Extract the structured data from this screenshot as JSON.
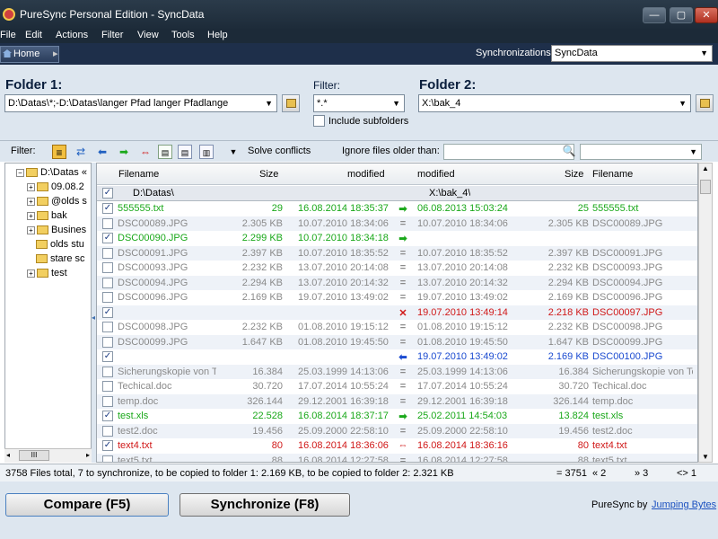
{
  "window": {
    "title": "PureSync Personal Edition  -  SyncData",
    "min": "—",
    "max": "▢",
    "close": "✕"
  },
  "menu": [
    "File",
    "Edit",
    "Actions",
    "Filter",
    "View",
    "Tools",
    "Help"
  ],
  "nav": {
    "home": "Home",
    "sync_label": "Synchronizations:",
    "sync_value": "SyncData"
  },
  "folder1": {
    "label": "Folder 1:",
    "path": "D:\\Datas\\*;-D:\\Datas\\langer Pfad langer Pfadlange"
  },
  "filter": {
    "label": "Filter:",
    "value": "*.*",
    "include_subfolders": "Include subfolders"
  },
  "folder2": {
    "label": "Folder 2:",
    "path": "X:\\bak_4"
  },
  "toolbar": {
    "filter_label": "Filter:",
    "solve_conflicts": "Solve conflicts",
    "ignore_label": "Ignore files older than:"
  },
  "tree": {
    "root": "D:\\Datas «",
    "items": [
      {
        "label": "09.08.2",
        "expand": true
      },
      {
        "label": "@olds s",
        "expand": true
      },
      {
        "label": "bak",
        "expand": true
      },
      {
        "label": "Busines",
        "expand": true
      },
      {
        "label": "olds stu",
        "expand": false
      },
      {
        "label": "stare sc",
        "expand": false
      },
      {
        "label": "test",
        "expand": true
      }
    ],
    "scroll_thumb": "III"
  },
  "columns": {
    "filename1": "Filename",
    "size1": "Size",
    "modified1": "modified",
    "modified2": "modified",
    "size2": "Size",
    "filename2": "Filename"
  },
  "folder_row": {
    "left": "D:\\Datas\\",
    "right": "X:\\bak_4\\"
  },
  "rows": [
    {
      "checked": true,
      "name1": "555555.txt",
      "size1": "29",
      "mod1": "16.08.2014 18:35:37",
      "action": "➡",
      "mod2": "06.08.2013 15:03:24",
      "size2": "25",
      "name2": "555555.txt",
      "color": "#1aa81a"
    },
    {
      "checked": false,
      "name1": "DSC00089.JPG",
      "size1": "2.305 KB",
      "mod1": "10.07.2010 18:34:06",
      "action": "=",
      "mod2": "10.07.2010 18:34:06",
      "size2": "2.305 KB",
      "name2": "DSC00089.JPG",
      "color": "#8a8a8a"
    },
    {
      "checked": true,
      "name1": "DSC00090.JPG",
      "size1": "2.299 KB",
      "mod1": "10.07.2010 18:34:18",
      "action": "➡",
      "mod2": "",
      "size2": "",
      "name2": "",
      "color": "#1aa81a"
    },
    {
      "checked": false,
      "name1": "DSC00091.JPG",
      "size1": "2.397 KB",
      "mod1": "10.07.2010 18:35:52",
      "action": "=",
      "mod2": "10.07.2010 18:35:52",
      "size2": "2.397 KB",
      "name2": "DSC00091.JPG",
      "color": "#8a8a8a"
    },
    {
      "checked": false,
      "name1": "DSC00093.JPG",
      "size1": "2.232 KB",
      "mod1": "13.07.2010 20:14:08",
      "action": "=",
      "mod2": "13.07.2010 20:14:08",
      "size2": "2.232 KB",
      "name2": "DSC00093.JPG",
      "color": "#8a8a8a"
    },
    {
      "checked": false,
      "name1": "DSC00094.JPG",
      "size1": "2.294 KB",
      "mod1": "13.07.2010 20:14:32",
      "action": "=",
      "mod2": "13.07.2010 20:14:32",
      "size2": "2.294 KB",
      "name2": "DSC00094.JPG",
      "color": "#8a8a8a"
    },
    {
      "checked": false,
      "name1": "DSC00096.JPG",
      "size1": "2.169 KB",
      "mod1": "19.07.2010 13:49:02",
      "action": "=",
      "mod2": "19.07.2010 13:49:02",
      "size2": "2.169 KB",
      "name2": "DSC00096.JPG",
      "color": "#8a8a8a"
    },
    {
      "checked": true,
      "name1": "",
      "size1": "",
      "mod1": "",
      "action": "✕",
      "mod2": "19.07.2010 13:49:14",
      "size2": "2.218 KB",
      "name2": "DSC00097.JPG",
      "color": "#d01818"
    },
    {
      "checked": false,
      "name1": "DSC00098.JPG",
      "size1": "2.232 KB",
      "mod1": "01.08.2010 19:15:12",
      "action": "=",
      "mod2": "01.08.2010 19:15:12",
      "size2": "2.232 KB",
      "name2": "DSC00098.JPG",
      "color": "#8a8a8a"
    },
    {
      "checked": false,
      "name1": "DSC00099.JPG",
      "size1": "1.647 KB",
      "mod1": "01.08.2010 19:45:50",
      "action": "=",
      "mod2": "01.08.2010 19:45:50",
      "size2": "1.647 KB",
      "name2": "DSC00099.JPG",
      "color": "#8a8a8a"
    },
    {
      "checked": true,
      "name1": "",
      "size1": "",
      "mod1": "",
      "action": "⬅",
      "mod2": "19.07.2010 13:49:02",
      "size2": "2.169 KB",
      "name2": "DSC00100.JPG",
      "color": "#1a4ad0"
    },
    {
      "checked": false,
      "name1": "Sicherungskopie von Te",
      "size1": "16.384",
      "mod1": "25.03.1999 14:13:06",
      "action": "=",
      "mod2": "25.03.1999 14:13:06",
      "size2": "16.384",
      "name2": "Sicherungskopie von Te",
      "color": "#8a8a8a"
    },
    {
      "checked": false,
      "name1": "Techical.doc",
      "size1": "30.720",
      "mod1": "17.07.2014 10:55:24",
      "action": "=",
      "mod2": "17.07.2014 10:55:24",
      "size2": "30.720",
      "name2": "Techical.doc",
      "color": "#8a8a8a"
    },
    {
      "checked": false,
      "name1": "temp.doc",
      "size1": "326.144",
      "mod1": "29.12.2001 16:39:18",
      "action": "=",
      "mod2": "29.12.2001 16:39:18",
      "size2": "326.144",
      "name2": "temp.doc",
      "color": "#8a8a8a"
    },
    {
      "checked": true,
      "name1": "test.xls",
      "size1": "22.528",
      "mod1": "16.08.2014 18:37:17",
      "action": "➡",
      "mod2": "25.02.2011 14:54:03",
      "size2": "13.824",
      "name2": "test.xls",
      "color": "#1aa81a"
    },
    {
      "checked": false,
      "name1": "test2.doc",
      "size1": "19.456",
      "mod1": "25.09.2000 22:58:10",
      "action": "=",
      "mod2": "25.09.2000 22:58:10",
      "size2": "19.456",
      "name2": "test2.doc",
      "color": "#8a8a8a"
    },
    {
      "checked": true,
      "name1": "text4.txt",
      "size1": "80",
      "mod1": "16.08.2014 18:36:06",
      "action": "⇔",
      "mod2": "16.08.2014 18:36:16",
      "size2": "80",
      "name2": "text4.txt",
      "color": "#d01818"
    },
    {
      "checked": false,
      "name1": "text5.txt",
      "size1": "88",
      "mod1": "16.08.2014 12:27:58",
      "action": "=",
      "mod2": "16.08.2014 12:27:58",
      "size2": "88",
      "name2": "text5.txt",
      "color": "#8a8a8a"
    }
  ],
  "status": {
    "summary": "3758 Files total,  7 to synchronize,  to be copied to folder 1: 2.169 KB,  to be copied to folder 2: 2.321 KB",
    "eq": "= 3751",
    "left": "« 2",
    "right": "» 3",
    "both": "<> 1"
  },
  "buttons": {
    "compare": "Compare (F5)",
    "synchronize": "Synchronize (F8)"
  },
  "footer": {
    "brand": "PureSync by",
    "link": "Jumping Bytes"
  }
}
